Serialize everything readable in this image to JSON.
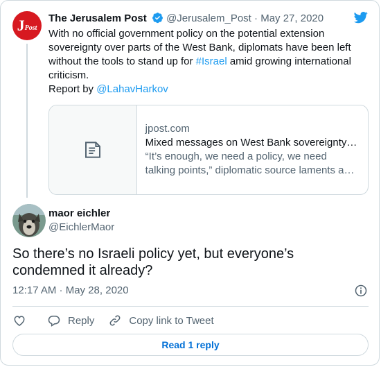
{
  "tweet": {
    "author_name": "The Jerusalem Post",
    "author_handle": "@Jerusalem_Post",
    "separator": "·",
    "date": "May 27, 2020",
    "avatar_text_big": "J",
    "avatar_text_small": "Post",
    "text_part1": "With no official government policy on the potential extension sovereignty over parts of the West Bank, diplomats have been left without the tools to stand up for ",
    "hashtag": "#Israel",
    "text_part2": " amid growing international criticism.",
    "report_prefix": "Report by ",
    "report_mention": "@LahavHarkov",
    "link_card": {
      "domain": "jpost.com",
      "title": "Mixed messages on West Bank sovereignty…",
      "description": "“It’s enough, we need a policy, we need talking points,” diplomatic source laments a…"
    }
  },
  "reply": {
    "author_name": "maor eichler",
    "author_handle": "@EichlerMaor",
    "text": "So there’s no Israeli policy yet, but everyone’s condemned it already?",
    "timestamp": "12:17 AM · May 28, 2020"
  },
  "actions": {
    "reply_label": "Reply",
    "copy_label": "Copy link to Tweet"
  },
  "read_replies_label": "Read 1 reply",
  "colors": {
    "accent": "#1d9bf0",
    "link_button": "#006fd6",
    "muted": "#536471",
    "border": "#cfd9de",
    "jp_red": "#d71920"
  }
}
